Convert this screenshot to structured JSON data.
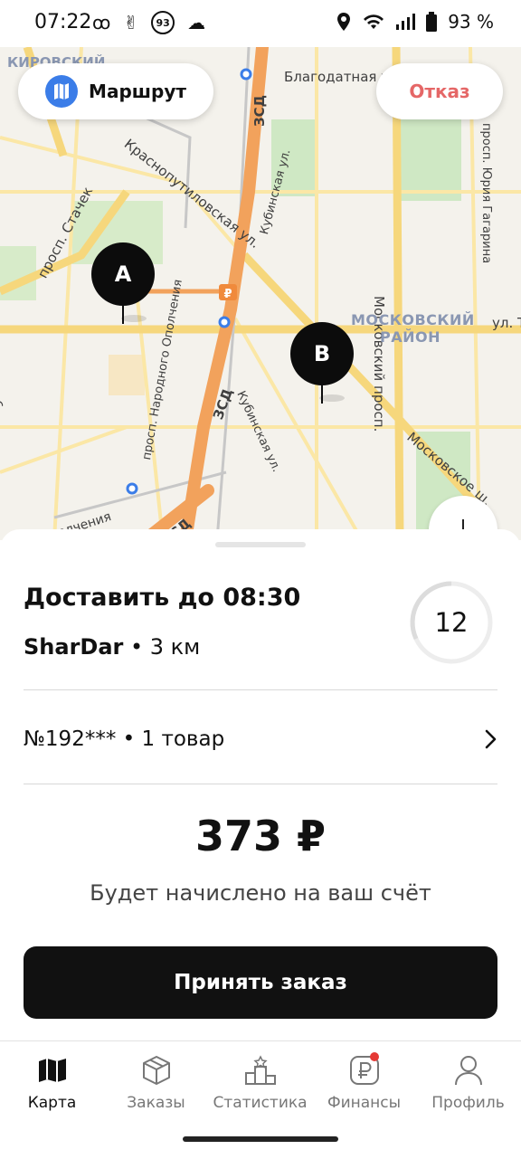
{
  "status_bar": {
    "time": "07:22",
    "badge": "93",
    "battery": "93 %"
  },
  "map": {
    "route_button_label": "Маршрут",
    "cancel_button_label": "Отказ",
    "pin_a": "A",
    "pin_b": "B",
    "labels": {
      "kirovsky": "КИРОВСКИЙ",
      "blagodatnaya": "Благодатная ул.",
      "zsd_1": "ЗСД",
      "zsd_2": "ЗСД",
      "zsd_3": "ЗСД",
      "kubinskaya_1": "Кубинская ул.",
      "kubinskaya_2": "Кубинская ул.",
      "krasnoputilovskaya": "Краснопутиловская ул.",
      "moskovsky_prosp": "Московский просп.",
      "gagarina": "просп. Юрия Гагарина",
      "stachek": "просп. Стачек",
      "narodnogo": "просп. Народного Ополчения",
      "moskovskoe": "Московское ш.",
      "district": "МОСКОВСКИЙ",
      "district_2": "РАЙОН",
      "ul_t": "ул. Т",
      "pro": "рос",
      "opolch": "олчения"
    }
  },
  "order": {
    "deliver_until": "Доставить до 08:30",
    "store": "SharDar",
    "distance": " • 3 км",
    "timer": "12",
    "number": "№192*** • 1 товар",
    "price": "373 ₽",
    "price_note": "Будет начислено на ваш счёт",
    "accept_label": "Принять заказ"
  },
  "nav": {
    "items": [
      {
        "label": "Карта",
        "icon": "map-icon",
        "active": true
      },
      {
        "label": "Заказы",
        "icon": "box-icon",
        "active": false
      },
      {
        "label": "Статистика",
        "icon": "podium-icon",
        "active": false
      },
      {
        "label": "Финансы",
        "icon": "ruble-icon",
        "active": false
      },
      {
        "label": "Профиль",
        "icon": "profile-icon",
        "active": false
      }
    ]
  },
  "colors": {
    "accent_blue": "#3b7de8",
    "cancel_red": "#e56767",
    "road_orange": "#f2a25c",
    "road_yellow": "#f6d77c"
  }
}
